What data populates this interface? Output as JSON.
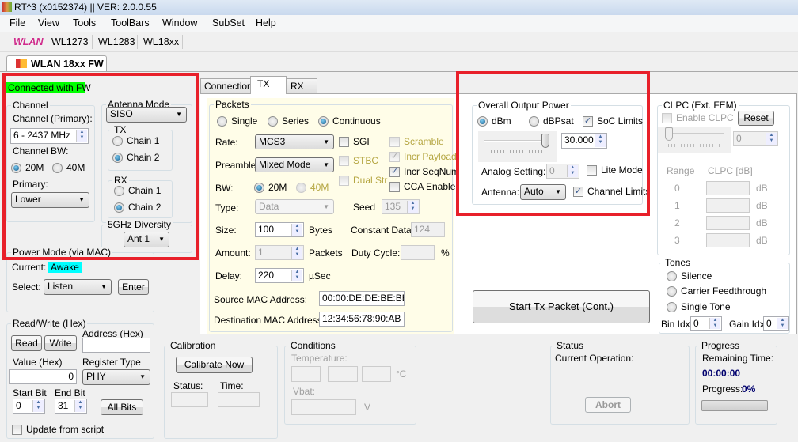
{
  "window": {
    "title": "RT^3 (x0152374) || VER: 2.0.0.55"
  },
  "menu": [
    "File",
    "View",
    "Tools",
    "ToolBars",
    "Window",
    "SubSet",
    "Help"
  ],
  "toolbar": {
    "brand": "WLAN",
    "items": [
      "WL1273",
      "WL1283",
      "WL18xx"
    ]
  },
  "main_tab": "WLAN 18xx FW",
  "status_connected": "Connected with FW",
  "colors": {
    "connected": "#00ff00",
    "awake": "#00ffff",
    "highlight": "#e8202a",
    "packets_bg": "#fffde8"
  },
  "channel": {
    "title": "Channel",
    "primary_label": "Channel (Primary):",
    "primary_value": "6  - 2437 MHz",
    "bw_label": "Channel BW:",
    "bw_options": [
      "20M",
      "40M"
    ],
    "bw_selected": "20M",
    "primary_sb_label": "Primary:",
    "primary_sb_value": "Lower"
  },
  "antenna": {
    "title": "Antenna Mode",
    "mode": "SISO",
    "tx_title": "TX",
    "rx_title": "RX",
    "chain1": "Chain 1",
    "chain2": "Chain 2",
    "tx_selected": "Chain 2",
    "rx_selected": "Chain 2",
    "div_title": "5GHz Diversity",
    "div_value": "Ant 1"
  },
  "power_mode": {
    "title": "Power Mode (via MAC)",
    "current_label": "Current:",
    "current_value": "Awake",
    "select_label": "Select:",
    "select_value": "Listen",
    "enter": "Enter"
  },
  "rw": {
    "title": "Read/Write (Hex)",
    "read": "Read",
    "write": "Write",
    "address_label": "Address (Hex)",
    "address_value": "",
    "value_label": "Value (Hex)",
    "value": "0",
    "regtype_label": "Register Type",
    "regtype": "PHY",
    "start_label": "Start Bit",
    "start": "0",
    "end_label": "End Bit",
    "end": "31",
    "all_bits": "All Bits",
    "update": "Update from script"
  },
  "tabs": [
    "Connection",
    "TX",
    "RX"
  ],
  "active_tab": "TX",
  "packets": {
    "title": "Packets",
    "modes": [
      "Single",
      "Series",
      "Continuous"
    ],
    "mode_selected": "Continuous",
    "rate_label": "Rate:",
    "rate": "MCS3",
    "preamble_label": "Preamble:",
    "preamble": "Mixed Mode",
    "bw_label": "BW:",
    "bw20": "20M",
    "bw40": "40M",
    "type_label": "Type:",
    "type": "Data",
    "seed_label": "Seed",
    "seed": "135",
    "size_label": "Size:",
    "size": "100",
    "bytes": "Bytes",
    "const_label": "Constant Data",
    "const": "124",
    "amount_label": "Amount:",
    "amount": "1",
    "packets": "Packets",
    "duty_label": "Duty Cycle:",
    "duty": "",
    "pct": "%",
    "delay_label": "Delay:",
    "delay": "220",
    "usec": "µSec",
    "src_label": "Source MAC Address:",
    "src": "00:00:DE:DE:BE:BE",
    "dst_label": "Destination MAC Address:",
    "dst": "12:34:56:78:90:AB",
    "checks": {
      "sgi": "SGI",
      "stbc": "STBC",
      "dual": "Dual Str",
      "scramble": "Scramble",
      "incr_payload": "Incr Payload",
      "incr_seq": "Incr SeqNum",
      "cca": "CCA Enable"
    },
    "checked": {
      "sgi": false,
      "stbc": false,
      "dual": false,
      "scramble": false,
      "incr_payload": true,
      "incr_seq": true,
      "cca": false
    }
  },
  "output": {
    "title": "Overall Output Power",
    "dbm": "dBm",
    "dbpsat": "dBPsat",
    "unit_selected": "dBm",
    "soc": "SoC Limits",
    "soc_checked": true,
    "value": "30.000",
    "slider_fraction": 1.0,
    "analog_label": "Analog Setting:",
    "analog": "0",
    "lite": "Lite Mode",
    "lite_checked": false,
    "antenna_label": "Antenna:",
    "antenna": "Auto",
    "chan_limits": "Channel Limits",
    "chan_limits_checked": true
  },
  "clpc": {
    "title": "CLPC (Ext. FEM)",
    "enable": "Enable CLPC",
    "reset": "Reset",
    "value": "0",
    "slider_fraction": 0,
    "range_label": "Range",
    "clpc_label": "CLPC [dB]",
    "rows": [
      "0",
      "1",
      "2",
      "3"
    ],
    "unit": "dB"
  },
  "tones": {
    "title": "Tones",
    "options": [
      "Silence",
      "Carrier Feedthrough",
      "Single Tone"
    ],
    "bin_label": "Bin Idx",
    "bin": "0",
    "gain_label": "Gain Idx",
    "gain": "0"
  },
  "start_tx": "Start Tx Packet (Cont.)",
  "calibration": {
    "title": "Calibration",
    "button": "Calibrate Now",
    "status_label": "Status:",
    "time_label": "Time:"
  },
  "conditions": {
    "title": "Conditions",
    "temp_label": "Temperature:",
    "celsius": "°C",
    "vbat_label": "Vbat:",
    "volt": "V"
  },
  "status": {
    "title": "Status",
    "current_op": "Current Operation:",
    "abort": "Abort"
  },
  "progress": {
    "title": "Progress",
    "remaining_label": "Remaining Time:",
    "remaining": "00:00:00",
    "progress_label": "Progress:",
    "progress": "0%",
    "fraction": 0
  }
}
